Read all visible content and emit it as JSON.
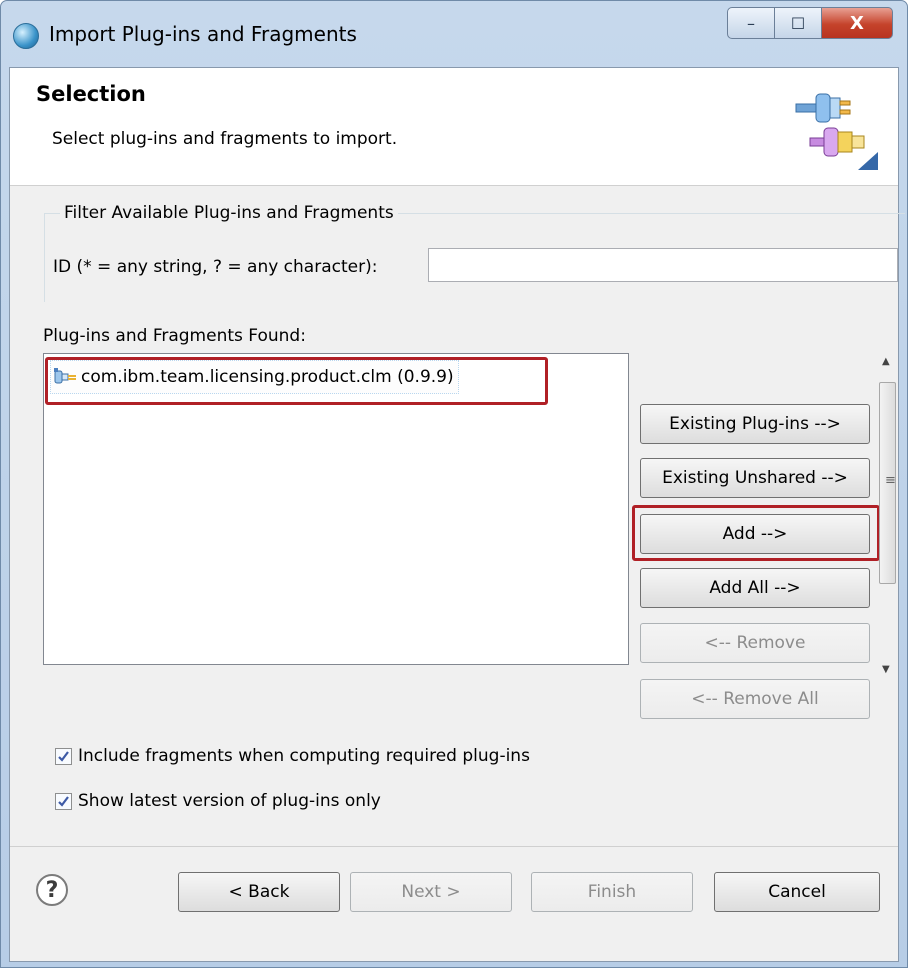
{
  "window": {
    "title": "Import Plug-ins and Fragments",
    "controls": {
      "minimize": "–",
      "maximize": "☐",
      "close": "X"
    }
  },
  "header": {
    "title": "Selection",
    "description": "Select plug-ins and fragments to import."
  },
  "filter": {
    "legend": "Filter Available Plug-ins and Fragments",
    "id_label": "ID (* = any string, ? = any character):",
    "id_value": ""
  },
  "found": {
    "label": "Plug-ins and Fragments Found:",
    "items": [
      {
        "label": "com.ibm.team.licensing.product.clm (0.9.9)"
      }
    ]
  },
  "actions": {
    "existing_plugins": "Existing Plug-ins -->",
    "existing_unshared": "Existing Unshared -->",
    "add": "Add -->",
    "add_all": "Add All -->",
    "remove": "<-- Remove",
    "remove_all": "<-- Remove All"
  },
  "options": {
    "include_fragments": {
      "label": "Include fragments when computing required plug-ins",
      "checked": true
    },
    "latest_version": {
      "label": "Show latest version of plug-ins only",
      "checked": true
    }
  },
  "footer": {
    "help": "?",
    "back": "< Back",
    "next": "Next >",
    "finish": "Finish",
    "cancel": "Cancel"
  },
  "colors": {
    "highlight": "#b02026",
    "title_bar": "#c6d8ec",
    "close_button": "#c5432b"
  }
}
